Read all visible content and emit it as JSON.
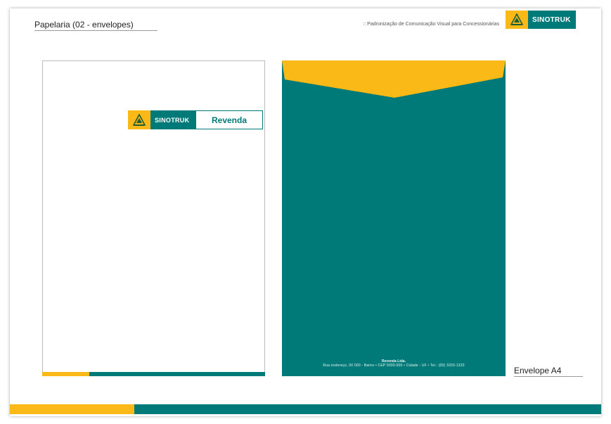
{
  "header": {
    "section_title": "Papelaria (02 - envelopes)",
    "tagline": ":: Padronização de Comunicação Visual para Concessionárias",
    "brand": "SINOTRUK"
  },
  "envelope_front": {
    "brand": "SINOTRUK",
    "dealer_label": "Revenda"
  },
  "envelope_back": {
    "company": "Revenda Ltda.",
    "address": "Rua endereço, 00 000 - Bairro • CEP 0000-000 • Cidade - UF • Tel.: (00) 3333-1333"
  },
  "caption": "Envelope A4",
  "colors": {
    "brand_yellow": "#fbb917",
    "brand_teal": "#007a78"
  },
  "icons": {
    "logo": "sinotruk-triangle-logo-icon"
  }
}
